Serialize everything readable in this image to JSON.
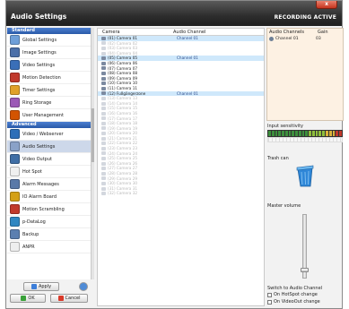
{
  "window": {
    "title": "Audio Settings",
    "status": "RECORDING ACTIVE",
    "close_glyph": "x",
    "accent": "#2a5aa8",
    "title_bg": "#2d2d2d"
  },
  "sidebar": {
    "sections": [
      {
        "heading": "Standard",
        "items": [
          {
            "label": "Global Settings",
            "icon": "globe-icon",
            "color": "#6f9fd8"
          },
          {
            "label": "Image Settings",
            "icon": "image-icon",
            "color": "#4b6fa8"
          },
          {
            "label": "Video Settings",
            "icon": "video-icon",
            "color": "#3a6fb8"
          },
          {
            "label": "Motion Detection",
            "icon": "motion-icon",
            "color": "#c0392b"
          },
          {
            "label": "Timer Settings",
            "icon": "timer-icon",
            "color": "#e0a12a"
          },
          {
            "label": "Ring Storage",
            "icon": "ring-icon",
            "color": "#9b59b6"
          },
          {
            "label": "User Management",
            "icon": "user-icon",
            "color": "#d35400"
          }
        ]
      },
      {
        "heading": "Advanced",
        "items": [
          {
            "label": "Video / Webserver",
            "icon": "webserver-icon",
            "color": "#2d6fb8"
          },
          {
            "label": "Audio Settings",
            "icon": "audio-icon",
            "color": "#8aa2c8",
            "selected": true
          },
          {
            "label": "Video Output",
            "icon": "video-output-icon",
            "color": "#3f6ea5"
          },
          {
            "label": "Hot Spot",
            "icon": "hotspot-icon",
            "color": "#f0f0f0"
          },
          {
            "label": "Alarm Messages",
            "icon": "alarm-icon",
            "color": "#5a79a8"
          },
          {
            "label": "IO Alarm Board",
            "icon": "io-board-icon",
            "color": "#d4a017"
          },
          {
            "label": "Motion Scrambling",
            "icon": "scramble-icon",
            "color": "#c0392b"
          },
          {
            "label": "p-DataLog",
            "icon": "datalog-icon",
            "color": "#2e86c1"
          },
          {
            "label": "Backup",
            "icon": "backup-icon",
            "color": "#5b7fb0"
          },
          {
            "label": "ANPR",
            "icon": "anpr-icon",
            "color": "#eeeeee"
          }
        ]
      }
    ],
    "apply_label": "Apply",
    "ok_label": "OK",
    "cancel_label": "Cancel"
  },
  "cameras": {
    "col_camera": "Camera",
    "col_channel": "Audio Channel",
    "rows": [
      {
        "name": "(01) Camera 01",
        "channel": "Channel 01",
        "highlight": true,
        "enabled": true
      },
      {
        "name": "(02) Camera 02",
        "channel": "",
        "enabled": false
      },
      {
        "name": "(03) Camera 03",
        "channel": "",
        "enabled": false
      },
      {
        "name": "(04) Camera 04",
        "channel": "",
        "enabled": false
      },
      {
        "name": "(05) Camera 05",
        "channel": "Channel 01",
        "highlight": true,
        "enabled": true
      },
      {
        "name": "(06) Camera 06",
        "channel": "",
        "enabled": true
      },
      {
        "name": "(07) Camera 07",
        "channel": "",
        "enabled": true
      },
      {
        "name": "(08) Camera 08",
        "channel": "",
        "enabled": true
      },
      {
        "name": "(09) Camera 09",
        "channel": "",
        "enabled": true
      },
      {
        "name": "(10) Camera 10",
        "channel": "",
        "enabled": true
      },
      {
        "name": "(11) Camera 11",
        "channel": "",
        "enabled": true
      },
      {
        "name": "(12) Fußgängerzone",
        "channel": "Channel 01",
        "highlight": true,
        "enabled": true
      },
      {
        "name": "(13) Camera 13",
        "channel": "",
        "enabled": false
      },
      {
        "name": "(14) Camera 14",
        "channel": "",
        "enabled": false
      },
      {
        "name": "(15) Camera 15",
        "channel": "",
        "enabled": false
      },
      {
        "name": "(16) Camera 16",
        "channel": "",
        "enabled": false
      },
      {
        "name": "(17) Camera 17",
        "channel": "",
        "enabled": false
      },
      {
        "name": "(18) Camera 18",
        "channel": "",
        "enabled": false
      },
      {
        "name": "(19) Camera 19",
        "channel": "",
        "enabled": false
      },
      {
        "name": "(20) Camera 20",
        "channel": "",
        "enabled": false
      },
      {
        "name": "(21) Camera 21",
        "channel": "",
        "enabled": false
      },
      {
        "name": "(22) Camera 22",
        "channel": "",
        "enabled": false
      },
      {
        "name": "(23) Camera 23",
        "channel": "",
        "enabled": false
      },
      {
        "name": "(24) Camera 24",
        "channel": "",
        "enabled": false
      },
      {
        "name": "(25) Camera 25",
        "channel": "",
        "enabled": false
      },
      {
        "name": "(26) Camera 26",
        "channel": "",
        "enabled": false
      },
      {
        "name": "(27) Camera 27",
        "channel": "",
        "enabled": false
      },
      {
        "name": "(28) Camera 28",
        "channel": "",
        "enabled": false
      },
      {
        "name": "(29) Camera 29",
        "channel": "",
        "enabled": false
      },
      {
        "name": "(30) Camera 30",
        "channel": "",
        "enabled": false
      },
      {
        "name": "(31) Camera 31",
        "channel": "",
        "enabled": false
      },
      {
        "name": "(32) Camera 32",
        "channel": "",
        "enabled": false
      }
    ]
  },
  "audio": {
    "col_channels": "Audio Channels",
    "col_gain": "Gain",
    "channels": [
      {
        "name": "Channel 01",
        "gain": "03"
      }
    ],
    "input_sensitivity_label": "Input sensitivity",
    "trash_label": "Trash can",
    "master_volume_label": "Master volume",
    "master_volume_level": 0.15,
    "switch_heading": "Switch to Audio Channel",
    "on_hotspot": "On HotSpot change",
    "on_videoout": "On VideoOut change"
  }
}
